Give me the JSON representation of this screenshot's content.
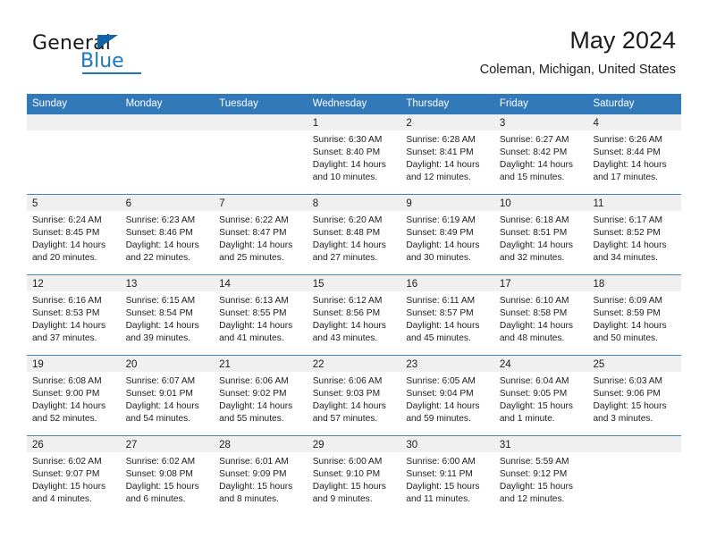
{
  "brand": {
    "name_dark": "General",
    "name_blue": "Blue",
    "color_blue": "#1a78c2",
    "triangle_color": "#1463a8",
    "triangle_icon": "triangle-icon"
  },
  "header": {
    "title": "May 2024",
    "subtitle": "Coleman, Michigan, United States"
  },
  "theme": {
    "header_band": "#3179b8",
    "row_divider": "#4a87bd",
    "date_strip": "#f0f0f0",
    "text": "#1c1c1c"
  },
  "weekdays": [
    "Sunday",
    "Monday",
    "Tuesday",
    "Wednesday",
    "Thursday",
    "Friday",
    "Saturday"
  ],
  "weeks": [
    {
      "days": [
        {
          "num": "",
          "sunrise": "",
          "sunset": "",
          "daylight1": "",
          "daylight2": "",
          "empty": true
        },
        {
          "num": "",
          "sunrise": "",
          "sunset": "",
          "daylight1": "",
          "daylight2": "",
          "empty": true
        },
        {
          "num": "",
          "sunrise": "",
          "sunset": "",
          "daylight1": "",
          "daylight2": "",
          "empty": true
        },
        {
          "num": "1",
          "sunrise": "Sunrise: 6:30 AM",
          "sunset": "Sunset: 8:40 PM",
          "daylight1": "Daylight: 14 hours",
          "daylight2": "and 10 minutes.",
          "empty": false
        },
        {
          "num": "2",
          "sunrise": "Sunrise: 6:28 AM",
          "sunset": "Sunset: 8:41 PM",
          "daylight1": "Daylight: 14 hours",
          "daylight2": "and 12 minutes.",
          "empty": false
        },
        {
          "num": "3",
          "sunrise": "Sunrise: 6:27 AM",
          "sunset": "Sunset: 8:42 PM",
          "daylight1": "Daylight: 14 hours",
          "daylight2": "and 15 minutes.",
          "empty": false
        },
        {
          "num": "4",
          "sunrise": "Sunrise: 6:26 AM",
          "sunset": "Sunset: 8:44 PM",
          "daylight1": "Daylight: 14 hours",
          "daylight2": "and 17 minutes.",
          "empty": false
        }
      ]
    },
    {
      "days": [
        {
          "num": "5",
          "sunrise": "Sunrise: 6:24 AM",
          "sunset": "Sunset: 8:45 PM",
          "daylight1": "Daylight: 14 hours",
          "daylight2": "and 20 minutes.",
          "empty": false
        },
        {
          "num": "6",
          "sunrise": "Sunrise: 6:23 AM",
          "sunset": "Sunset: 8:46 PM",
          "daylight1": "Daylight: 14 hours",
          "daylight2": "and 22 minutes.",
          "empty": false
        },
        {
          "num": "7",
          "sunrise": "Sunrise: 6:22 AM",
          "sunset": "Sunset: 8:47 PM",
          "daylight1": "Daylight: 14 hours",
          "daylight2": "and 25 minutes.",
          "empty": false
        },
        {
          "num": "8",
          "sunrise": "Sunrise: 6:20 AM",
          "sunset": "Sunset: 8:48 PM",
          "daylight1": "Daylight: 14 hours",
          "daylight2": "and 27 minutes.",
          "empty": false
        },
        {
          "num": "9",
          "sunrise": "Sunrise: 6:19 AM",
          "sunset": "Sunset: 8:49 PM",
          "daylight1": "Daylight: 14 hours",
          "daylight2": "and 30 minutes.",
          "empty": false
        },
        {
          "num": "10",
          "sunrise": "Sunrise: 6:18 AM",
          "sunset": "Sunset: 8:51 PM",
          "daylight1": "Daylight: 14 hours",
          "daylight2": "and 32 minutes.",
          "empty": false
        },
        {
          "num": "11",
          "sunrise": "Sunrise: 6:17 AM",
          "sunset": "Sunset: 8:52 PM",
          "daylight1": "Daylight: 14 hours",
          "daylight2": "and 34 minutes.",
          "empty": false
        }
      ]
    },
    {
      "days": [
        {
          "num": "12",
          "sunrise": "Sunrise: 6:16 AM",
          "sunset": "Sunset: 8:53 PM",
          "daylight1": "Daylight: 14 hours",
          "daylight2": "and 37 minutes.",
          "empty": false
        },
        {
          "num": "13",
          "sunrise": "Sunrise: 6:15 AM",
          "sunset": "Sunset: 8:54 PM",
          "daylight1": "Daylight: 14 hours",
          "daylight2": "and 39 minutes.",
          "empty": false
        },
        {
          "num": "14",
          "sunrise": "Sunrise: 6:13 AM",
          "sunset": "Sunset: 8:55 PM",
          "daylight1": "Daylight: 14 hours",
          "daylight2": "and 41 minutes.",
          "empty": false
        },
        {
          "num": "15",
          "sunrise": "Sunrise: 6:12 AM",
          "sunset": "Sunset: 8:56 PM",
          "daylight1": "Daylight: 14 hours",
          "daylight2": "and 43 minutes.",
          "empty": false
        },
        {
          "num": "16",
          "sunrise": "Sunrise: 6:11 AM",
          "sunset": "Sunset: 8:57 PM",
          "daylight1": "Daylight: 14 hours",
          "daylight2": "and 45 minutes.",
          "empty": false
        },
        {
          "num": "17",
          "sunrise": "Sunrise: 6:10 AM",
          "sunset": "Sunset: 8:58 PM",
          "daylight1": "Daylight: 14 hours",
          "daylight2": "and 48 minutes.",
          "empty": false
        },
        {
          "num": "18",
          "sunrise": "Sunrise: 6:09 AM",
          "sunset": "Sunset: 8:59 PM",
          "daylight1": "Daylight: 14 hours",
          "daylight2": "and 50 minutes.",
          "empty": false
        }
      ]
    },
    {
      "days": [
        {
          "num": "19",
          "sunrise": "Sunrise: 6:08 AM",
          "sunset": "Sunset: 9:00 PM",
          "daylight1": "Daylight: 14 hours",
          "daylight2": "and 52 minutes.",
          "empty": false
        },
        {
          "num": "20",
          "sunrise": "Sunrise: 6:07 AM",
          "sunset": "Sunset: 9:01 PM",
          "daylight1": "Daylight: 14 hours",
          "daylight2": "and 54 minutes.",
          "empty": false
        },
        {
          "num": "21",
          "sunrise": "Sunrise: 6:06 AM",
          "sunset": "Sunset: 9:02 PM",
          "daylight1": "Daylight: 14 hours",
          "daylight2": "and 55 minutes.",
          "empty": false
        },
        {
          "num": "22",
          "sunrise": "Sunrise: 6:06 AM",
          "sunset": "Sunset: 9:03 PM",
          "daylight1": "Daylight: 14 hours",
          "daylight2": "and 57 minutes.",
          "empty": false
        },
        {
          "num": "23",
          "sunrise": "Sunrise: 6:05 AM",
          "sunset": "Sunset: 9:04 PM",
          "daylight1": "Daylight: 14 hours",
          "daylight2": "and 59 minutes.",
          "empty": false
        },
        {
          "num": "24",
          "sunrise": "Sunrise: 6:04 AM",
          "sunset": "Sunset: 9:05 PM",
          "daylight1": "Daylight: 15 hours",
          "daylight2": "and 1 minute.",
          "empty": false
        },
        {
          "num": "25",
          "sunrise": "Sunrise: 6:03 AM",
          "sunset": "Sunset: 9:06 PM",
          "daylight1": "Daylight: 15 hours",
          "daylight2": "and 3 minutes.",
          "empty": false
        }
      ]
    },
    {
      "days": [
        {
          "num": "26",
          "sunrise": "Sunrise: 6:02 AM",
          "sunset": "Sunset: 9:07 PM",
          "daylight1": "Daylight: 15 hours",
          "daylight2": "and 4 minutes.",
          "empty": false
        },
        {
          "num": "27",
          "sunrise": "Sunrise: 6:02 AM",
          "sunset": "Sunset: 9:08 PM",
          "daylight1": "Daylight: 15 hours",
          "daylight2": "and 6 minutes.",
          "empty": false
        },
        {
          "num": "28",
          "sunrise": "Sunrise: 6:01 AM",
          "sunset": "Sunset: 9:09 PM",
          "daylight1": "Daylight: 15 hours",
          "daylight2": "and 8 minutes.",
          "empty": false
        },
        {
          "num": "29",
          "sunrise": "Sunrise: 6:00 AM",
          "sunset": "Sunset: 9:10 PM",
          "daylight1": "Daylight: 15 hours",
          "daylight2": "and 9 minutes.",
          "empty": false
        },
        {
          "num": "30",
          "sunrise": "Sunrise: 6:00 AM",
          "sunset": "Sunset: 9:11 PM",
          "daylight1": "Daylight: 15 hours",
          "daylight2": "and 11 minutes.",
          "empty": false
        },
        {
          "num": "31",
          "sunrise": "Sunrise: 5:59 AM",
          "sunset": "Sunset: 9:12 PM",
          "daylight1": "Daylight: 15 hours",
          "daylight2": "and 12 minutes.",
          "empty": false
        },
        {
          "num": "",
          "sunrise": "",
          "sunset": "",
          "daylight1": "",
          "daylight2": "",
          "empty": true
        }
      ]
    }
  ]
}
